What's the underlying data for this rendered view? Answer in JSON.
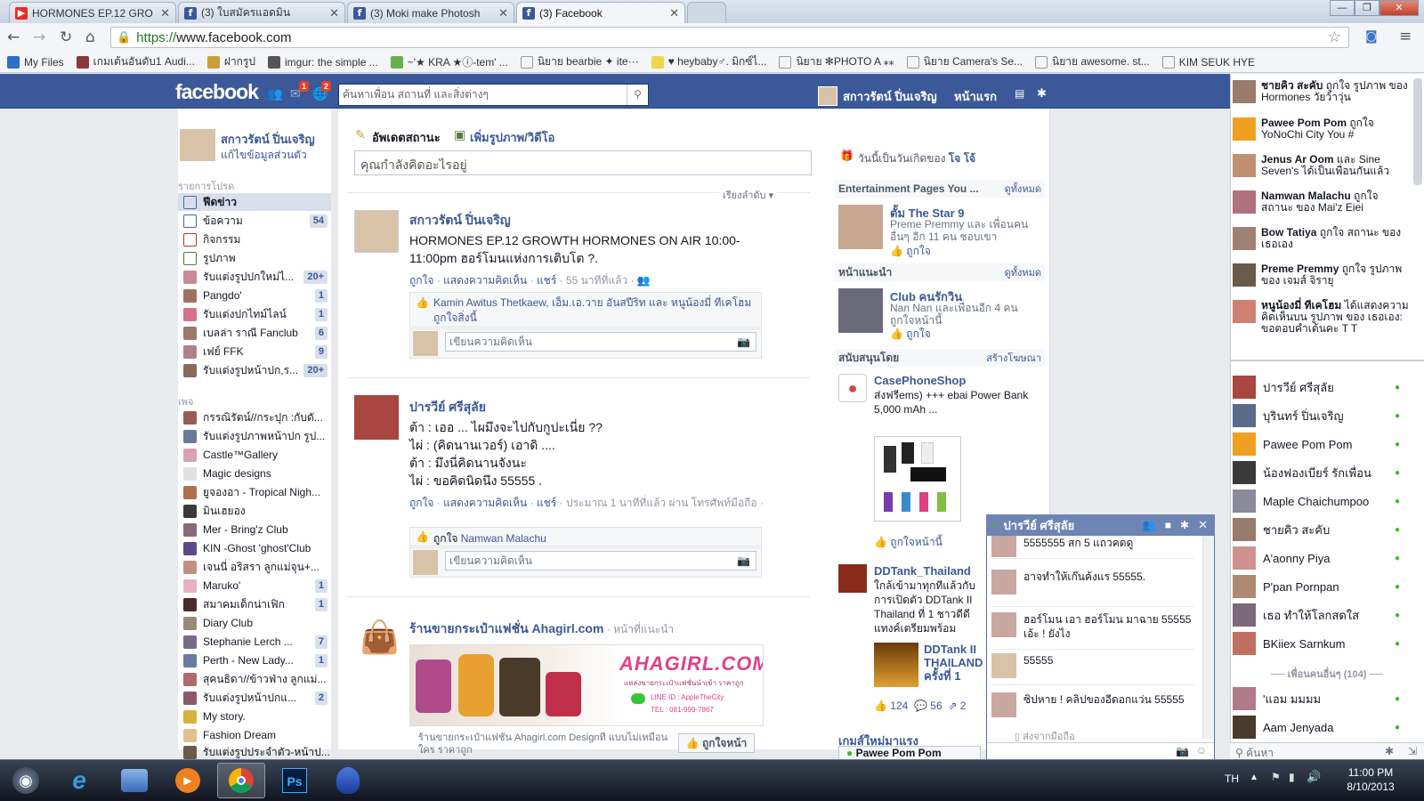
{
  "browser": {
    "tabs": [
      {
        "title": "HORMONES EP.12 GRO",
        "fav": "youtube"
      },
      {
        "title": "(3) ใบสมัครแอดมิน",
        "fav": "facebook"
      },
      {
        "title": "(3) Moki make Photosh",
        "fav": "facebook"
      },
      {
        "title": "(3) Facebook",
        "fav": "facebook"
      }
    ],
    "url_scheme": "https://",
    "url_host": "www.facebook.com",
    "bookmarks": [
      "My Files",
      "เกมเต้นอันดับ1 Audi...",
      "ฝากรูป",
      "imgur: the simple ...",
      "~'★ KRA ★ⓘ-tem' ...",
      "นิยาย bearbie ✦ ite···",
      "♥ heybaby♂. มิกซ์ไ...",
      "นิยาย ✻PHOTO A ⁎⁎",
      "นิยาย Camera's Se...",
      "นิยาย awesome. st...",
      "KIM SEUK HYE"
    ]
  },
  "header": {
    "logo": "facebook",
    "badges": [
      "1",
      "2"
    ],
    "search_placeholder": "ค้นหาเพื่อน สถานที่ และสิ่งต่างๆ",
    "user_name": "สกาวรัตน์ ปิ่นเจริญ",
    "home": "หน้าแรก"
  },
  "left": {
    "profile_name": "สกาวรัตน์ ปิ่นเจริญ",
    "edit_profile": "แก้ไขข้อมูลส่วนตัว",
    "favorites_title": "รายการโปรด",
    "favorites": [
      {
        "label": "ฟีดข่าว",
        "count": ""
      },
      {
        "label": "ข้อความ",
        "count": "54"
      },
      {
        "label": "กิจกรรม",
        "count": ""
      },
      {
        "label": "รูปภาพ",
        "count": ""
      },
      {
        "label": "รับแต่งรูปปกใหม่ไ...",
        "count": "20+"
      },
      {
        "label": "Pangdo'",
        "count": "1"
      },
      {
        "label": "รับแต่งปกไทม์ไลน์",
        "count": "1"
      },
      {
        "label": "เบลล่า ราณี Fanclub",
        "count": "6"
      },
      {
        "label": "เฟย์ FFK",
        "count": "9"
      },
      {
        "label": "รับแต่งรูปหน้าปก,ร...",
        "count": "20+"
      }
    ],
    "pages_title": "เพจ",
    "pages": [
      {
        "label": "กรรณิรัตน์//กระปุก :กับดั...",
        "count": ""
      },
      {
        "label": "รับแต่งรูปภาพหน้าปก รูป...",
        "count": ""
      },
      {
        "label": "Castle™Gallery",
        "count": ""
      },
      {
        "label": "Magic designs",
        "count": ""
      },
      {
        "label": "ยูจองอา - Tropical Nigh...",
        "count": ""
      },
      {
        "label": "มินเฮยอง",
        "count": ""
      },
      {
        "label": "Mer - Bring'z Club",
        "count": ""
      },
      {
        "label": "KIN -Ghost 'ghost'Club",
        "count": ""
      },
      {
        "label": "เจนนี่ อริสรา ลูกแม่จุน+...",
        "count": ""
      },
      {
        "label": "Maruko'",
        "count": "1"
      },
      {
        "label": "สมาคมเด็กน่าเฟิก",
        "count": "1"
      },
      {
        "label": "Diary Club",
        "count": ""
      },
      {
        "label": "Stephanie Lerch ...",
        "count": "7"
      },
      {
        "label": "Perth - New Lady...",
        "count": "1"
      },
      {
        "label": "สุคนธิดา//ข้าวฟ่าง ลูกแม่...",
        "count": ""
      },
      {
        "label": "รับแต่งรูปหน้าปกแ...",
        "count": "2"
      },
      {
        "label": "My story.",
        "count": ""
      },
      {
        "label": "Fashion Dream",
        "count": ""
      },
      {
        "label": "รับแต่งรูปประจำตัว-หน้าป...",
        "count": ""
      }
    ]
  },
  "composer": {
    "update_status": "อัพเดตสถานะ",
    "add_photo": "เพิ่มรูปภาพ/วิดีโอ",
    "placeholder": "คุณกำลังคิดอะไรอยู่",
    "sort": "เรียงลำดับ"
  },
  "posts": [
    {
      "author": "สกาวรัตน์ ปิ่นเจริญ",
      "text": "HORMONES EP.12 GROWTH HORMONES ON AIR 10:00-11:00pm ฮอร์โมนแห่งการเติบโต ?.",
      "meta_like": "ถูกใจ",
      "meta_comment": "แสดงความคิดเห็น",
      "meta_share": "แชร์",
      "meta_time": "· 55 นาทีที่แล้ว ·",
      "likes_text": "Kamin Awitus Thetkaew, เอ็ม.เอ.วาย อันสปีริท และ หนูน้องมี่ ทีเคโฮม ถูกใจสิ่งนี้",
      "comment_placeholder": "เขียนความคิดเห็น"
    },
    {
      "author": "ปารวีย์ ศรีสุลัย",
      "lines": [
        "ต้า : เออ ... ไผมึงจะไปกับกูปะเนี่ย ??",
        "ไผ่ : (คิดนานเวอร์) เอาดิ ....",
        "ต้า : มึงนี่คิดนานจังนะ",
        "ไผ่ : ขอคิดนิดนึง 55555 ."
      ],
      "meta_like": "ถูกใจ",
      "meta_comment": "แสดงความคิดเห็น",
      "meta_share": "แชร์",
      "meta_time": "· ประมาณ 1 นาทีที่แล้ว ผ่าน โทรศัพท์มือถือ ·",
      "likes_prefix": "ถูกใจ",
      "likes_name": "Namwan Malachu",
      "comment_placeholder": "เขียนความคิดเห็น"
    },
    {
      "author": "ร้านขายกระเป๋าแฟชั่น Ahagirl.com",
      "suggest": "· หน้าที่แนะนำ",
      "banner": "AHAGIRL.COM",
      "banner_sub": "แหล่งขายกระเป๋าแฟชั่นนำเข้า ราคาถูก",
      "banner_line": "LINE ID : AppleTheCity",
      "banner_tel": "TEL : 081-999-7867",
      "desc": "ร้านขายกระเป๋าแฟชั่น Ahagirl.com Designที่ แบบไม่เหมือนใคร ราคาถูก",
      "like_page": "ถูกใจหน้า"
    }
  ],
  "right": {
    "birthday": "วันนี้เป็นวันเกิดของ",
    "birthday_name": "โจ โจ้",
    "ent_title": "Entertainment Pages You ...",
    "see_all": "ดูทั้งหมด",
    "ent_name": "ตั้ม The Star 9",
    "ent_sub": "Preme Premmy และ เพื่อนคนอื่นๆ อีก 11 คน ชอบเขา",
    "like": "ถูกใจ",
    "sug_title": "หน้าแนะนำ",
    "sug_name": "Club คนรักวิน",
    "sug_sub": "Nan Nan และเพื่อนอีก 4 คนถูกใจหน้านี้",
    "ad_title": "สนับสนุนโดย",
    "create_ad": "สร้างโฆษณา",
    "ad1_name": "CasePhoneShop",
    "ad1_text": "ส่งฟรีems) +++ ebai Power Bank 5,000 mAh ...",
    "like_page": "ถูกใจหน้านี้",
    "ad2_name": "DDTank_Thailand",
    "ad2_text": "ใกล้เข้ามาทุกทีแล้วกับการเปิดตัว DDTank II Thailand ที่ 1 ชาวดีดีแทงค์เตรียมพร้อม",
    "ad2_sub": "DDTank II THAILAND ครั้งที่ 1",
    "ad2_likes": "124",
    "ad2_comments": "56",
    "ad2_shares": "2",
    "games_title": "เกมส์ใหม่มาแรง",
    "chat_tab": "Pawee Pom Pom"
  },
  "ticker": [
    {
      "name": "ชายคิว สะคับ",
      "text": "ถูกใจ รูปภาพ ของ Hormones วัยว้าวุ่น"
    },
    {
      "name": "Pawee Pom Pom",
      "text": "ถูกใจ YoNoChi City You #"
    },
    {
      "name": "Jenus Ar Oom",
      "text": "และ Sine Seven's ได้เป็นเพื่อนกันแล้ว"
    },
    {
      "name": "Namwan Malachu",
      "text": "ถูกใจ สถานะ ของ Mai'z Eiei"
    },
    {
      "name": "Bow Tatiya",
      "text": "ถูกใจ สถานะ ของเธอเอง"
    },
    {
      "name": "Preme Premmy",
      "text": "ถูกใจ รูปภาพ ของ เจมส์ จิรายุ"
    },
    {
      "name": "หนูน้องมี่ ทีเคโฮม",
      "text": "ได้แสดงความคิดเห็นบน รูปภาพ ของ เธอเอง: ขอตอบคำเต้นคะ T T"
    }
  ],
  "chat_list": [
    "ปารวีย์ ศรีสุลัย",
    "บุรินทร์ ปิ่นเจริญ",
    "Pawee Pom Pom",
    "น้องฟองเบียร์ รักเพื่อน",
    "Maple Chaichumpoo",
    "ชายคิว สะคับ",
    "A'aonny Piya",
    "P'pan Pornpan",
    "เธอ ทำให้โลกสดใส",
    "BKiiex Sarnkum"
  ],
  "chat_more": "เพื่อนคนอื่นๆ (104)",
  "chat_list2": [
    "'แอม มมมม",
    "Aam Jenyada"
  ],
  "chat_search": "ค้นหา",
  "chat_window": {
    "title": "ปารวีย์ ศรีสุลัย",
    "messages": [
      "5555555 สก 5 แถวคดดู",
      "อาจทำให้เก๊นค้งแร 55555.",
      "ฮอร์โมน เอา ฮอร์โมน มาฉาย 55555 เอ้ะ ! ยังไง",
      "55555",
      "ซิปหาย ! คลิปของอีดอกแว่น 55555"
    ],
    "sent_from": "ส่งจากมือถือ"
  },
  "taskbar": {
    "lang": "TH",
    "time": "11:00 PM",
    "date": "8/10/2013"
  }
}
